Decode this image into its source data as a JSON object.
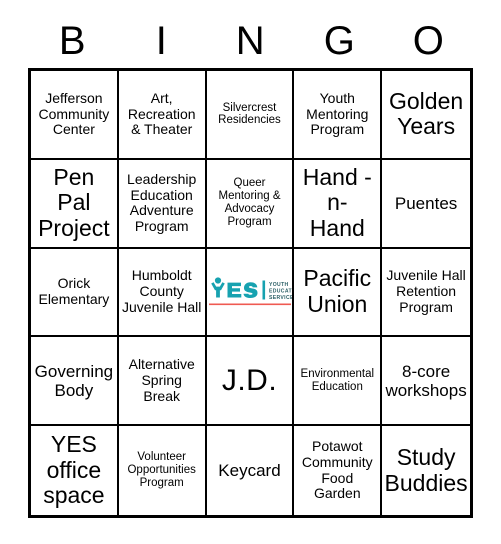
{
  "header": {
    "letters": [
      "B",
      "I",
      "N",
      "G",
      "O"
    ]
  },
  "grid": {
    "rows": [
      [
        {
          "label": "Jefferson Community Center",
          "size": "t-sm"
        },
        {
          "label": "Art, Recreation & Theater",
          "size": "t-sm"
        },
        {
          "label": "Silvercrest Residencies",
          "size": "t-xs"
        },
        {
          "label": "Youth Mentoring Program",
          "size": "t-sm"
        },
        {
          "label": "Golden Years",
          "size": "t-xl"
        }
      ],
      [
        {
          "label": "Pen Pal Project",
          "size": "t-xl"
        },
        {
          "label": "Leadership Education Adventure Program",
          "size": "t-sm"
        },
        {
          "label": "Queer Mentoring & Advocacy Program",
          "size": "t-xs"
        },
        {
          "label": "Hand -n- Hand",
          "size": "t-xl"
        },
        {
          "label": "Puentes",
          "size": "t-md"
        }
      ],
      [
        {
          "label": "Orick Elementary",
          "size": "t-sm"
        },
        {
          "label": "Humboldt County Juvenile Hall",
          "size": "t-sm"
        },
        {
          "label": "",
          "size": "t-sm",
          "type": "logo"
        },
        {
          "label": "Pacific Union",
          "size": "t-xl"
        },
        {
          "label": "Juvenile Hall Retention Program",
          "size": "t-sm"
        }
      ],
      [
        {
          "label": "Governing Body",
          "size": "t-md"
        },
        {
          "label": "Alternative Spring Break",
          "size": "t-sm"
        },
        {
          "label": "J.D.",
          "size": "t-huge"
        },
        {
          "label": "Environmental Education",
          "size": "t-xs"
        },
        {
          "label": "8-core workshops",
          "size": "t-md"
        }
      ],
      [
        {
          "label": "YES office space",
          "size": "t-xl"
        },
        {
          "label": "Volunteer Opportunities Program",
          "size": "t-xs"
        },
        {
          "label": "Keycard",
          "size": "t-md"
        },
        {
          "label": "Potawot Community Food Garden",
          "size": "t-sm"
        },
        {
          "label": "Study Buddies",
          "size": "t-xl"
        }
      ]
    ]
  },
  "logo": {
    "wordmark": "YES",
    "tagline_line1": "YOUTH",
    "tagline_line2": "EDUCATIONAL",
    "tagline_line3": "SERVICES",
    "mark_color": "#17a2b0",
    "accent_color": "#ef5a52",
    "tagline_color": "#2b5f66"
  },
  "colors": {
    "border": "#000000",
    "text": "#000000",
    "background": "#ffffff"
  }
}
